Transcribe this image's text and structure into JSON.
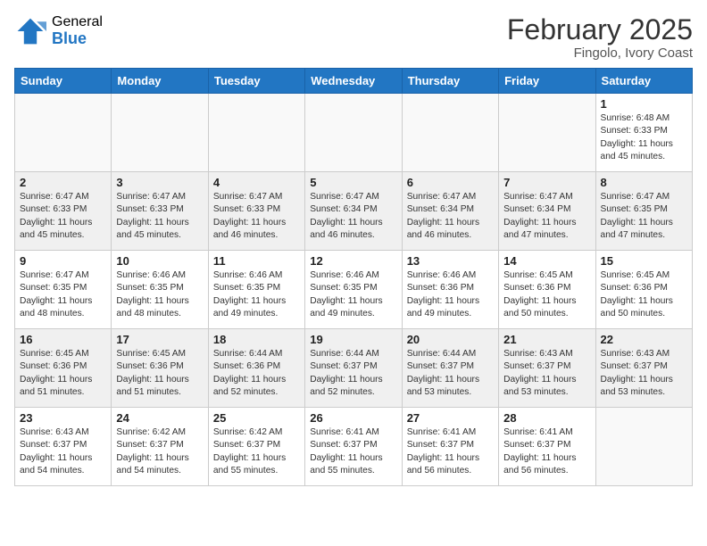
{
  "header": {
    "logo_general": "General",
    "logo_blue": "Blue",
    "month_year": "February 2025",
    "location": "Fingolo, Ivory Coast"
  },
  "weekdays": [
    "Sunday",
    "Monday",
    "Tuesday",
    "Wednesday",
    "Thursday",
    "Friday",
    "Saturday"
  ],
  "weeks": [
    [
      {
        "day": "",
        "info": ""
      },
      {
        "day": "",
        "info": ""
      },
      {
        "day": "",
        "info": ""
      },
      {
        "day": "",
        "info": ""
      },
      {
        "day": "",
        "info": ""
      },
      {
        "day": "",
        "info": ""
      },
      {
        "day": "1",
        "info": "Sunrise: 6:48 AM\nSunset: 6:33 PM\nDaylight: 11 hours\nand 45 minutes."
      }
    ],
    [
      {
        "day": "2",
        "info": "Sunrise: 6:47 AM\nSunset: 6:33 PM\nDaylight: 11 hours\nand 45 minutes."
      },
      {
        "day": "3",
        "info": "Sunrise: 6:47 AM\nSunset: 6:33 PM\nDaylight: 11 hours\nand 45 minutes."
      },
      {
        "day": "4",
        "info": "Sunrise: 6:47 AM\nSunset: 6:33 PM\nDaylight: 11 hours\nand 46 minutes."
      },
      {
        "day": "5",
        "info": "Sunrise: 6:47 AM\nSunset: 6:34 PM\nDaylight: 11 hours\nand 46 minutes."
      },
      {
        "day": "6",
        "info": "Sunrise: 6:47 AM\nSunset: 6:34 PM\nDaylight: 11 hours\nand 46 minutes."
      },
      {
        "day": "7",
        "info": "Sunrise: 6:47 AM\nSunset: 6:34 PM\nDaylight: 11 hours\nand 47 minutes."
      },
      {
        "day": "8",
        "info": "Sunrise: 6:47 AM\nSunset: 6:35 PM\nDaylight: 11 hours\nand 47 minutes."
      }
    ],
    [
      {
        "day": "9",
        "info": "Sunrise: 6:47 AM\nSunset: 6:35 PM\nDaylight: 11 hours\nand 48 minutes."
      },
      {
        "day": "10",
        "info": "Sunrise: 6:46 AM\nSunset: 6:35 PM\nDaylight: 11 hours\nand 48 minutes."
      },
      {
        "day": "11",
        "info": "Sunrise: 6:46 AM\nSunset: 6:35 PM\nDaylight: 11 hours\nand 49 minutes."
      },
      {
        "day": "12",
        "info": "Sunrise: 6:46 AM\nSunset: 6:35 PM\nDaylight: 11 hours\nand 49 minutes."
      },
      {
        "day": "13",
        "info": "Sunrise: 6:46 AM\nSunset: 6:36 PM\nDaylight: 11 hours\nand 49 minutes."
      },
      {
        "day": "14",
        "info": "Sunrise: 6:45 AM\nSunset: 6:36 PM\nDaylight: 11 hours\nand 50 minutes."
      },
      {
        "day": "15",
        "info": "Sunrise: 6:45 AM\nSunset: 6:36 PM\nDaylight: 11 hours\nand 50 minutes."
      }
    ],
    [
      {
        "day": "16",
        "info": "Sunrise: 6:45 AM\nSunset: 6:36 PM\nDaylight: 11 hours\nand 51 minutes."
      },
      {
        "day": "17",
        "info": "Sunrise: 6:45 AM\nSunset: 6:36 PM\nDaylight: 11 hours\nand 51 minutes."
      },
      {
        "day": "18",
        "info": "Sunrise: 6:44 AM\nSunset: 6:36 PM\nDaylight: 11 hours\nand 52 minutes."
      },
      {
        "day": "19",
        "info": "Sunrise: 6:44 AM\nSunset: 6:37 PM\nDaylight: 11 hours\nand 52 minutes."
      },
      {
        "day": "20",
        "info": "Sunrise: 6:44 AM\nSunset: 6:37 PM\nDaylight: 11 hours\nand 53 minutes."
      },
      {
        "day": "21",
        "info": "Sunrise: 6:43 AM\nSunset: 6:37 PM\nDaylight: 11 hours\nand 53 minutes."
      },
      {
        "day": "22",
        "info": "Sunrise: 6:43 AM\nSunset: 6:37 PM\nDaylight: 11 hours\nand 53 minutes."
      }
    ],
    [
      {
        "day": "23",
        "info": "Sunrise: 6:43 AM\nSunset: 6:37 PM\nDaylight: 11 hours\nand 54 minutes."
      },
      {
        "day": "24",
        "info": "Sunrise: 6:42 AM\nSunset: 6:37 PM\nDaylight: 11 hours\nand 54 minutes."
      },
      {
        "day": "25",
        "info": "Sunrise: 6:42 AM\nSunset: 6:37 PM\nDaylight: 11 hours\nand 55 minutes."
      },
      {
        "day": "26",
        "info": "Sunrise: 6:41 AM\nSunset: 6:37 PM\nDaylight: 11 hours\nand 55 minutes."
      },
      {
        "day": "27",
        "info": "Sunrise: 6:41 AM\nSunset: 6:37 PM\nDaylight: 11 hours\nand 56 minutes."
      },
      {
        "day": "28",
        "info": "Sunrise: 6:41 AM\nSunset: 6:37 PM\nDaylight: 11 hours\nand 56 minutes."
      },
      {
        "day": "",
        "info": ""
      }
    ]
  ]
}
